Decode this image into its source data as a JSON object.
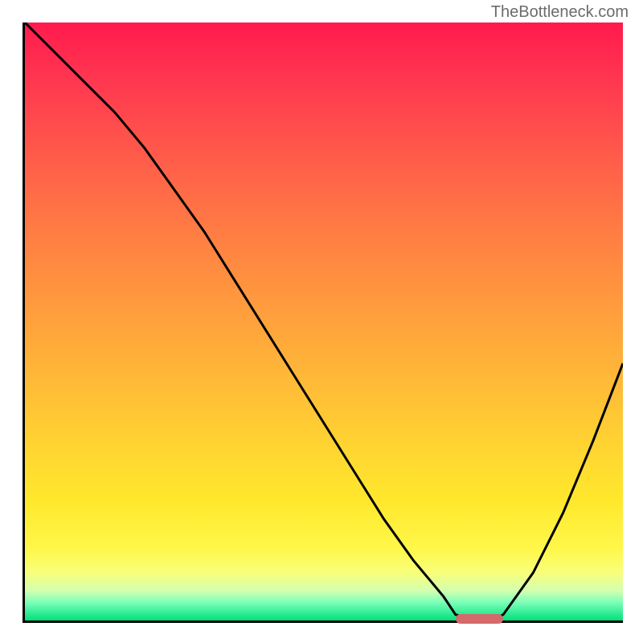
{
  "watermark": "TheBottleneck.com",
  "chart_data": {
    "type": "line",
    "title": "",
    "xlabel": "",
    "ylabel": "",
    "xlim": [
      0,
      100
    ],
    "ylim": [
      0,
      100
    ],
    "x": [
      0,
      5,
      10,
      15,
      20,
      25,
      30,
      35,
      40,
      45,
      50,
      55,
      60,
      65,
      70,
      72,
      75,
      78,
      80,
      85,
      90,
      95,
      100
    ],
    "values": [
      100,
      95,
      90,
      85,
      79,
      72,
      65,
      57,
      49,
      41,
      33,
      25,
      17,
      10,
      4,
      1,
      0,
      0,
      1,
      8,
      18,
      30,
      43
    ],
    "gradient_theme": "bottleneck-red-yellow-green",
    "marker": {
      "x_start": 72,
      "x_end": 80,
      "y": 0,
      "color": "#d46a6a"
    },
    "grid": false,
    "legend": false
  }
}
